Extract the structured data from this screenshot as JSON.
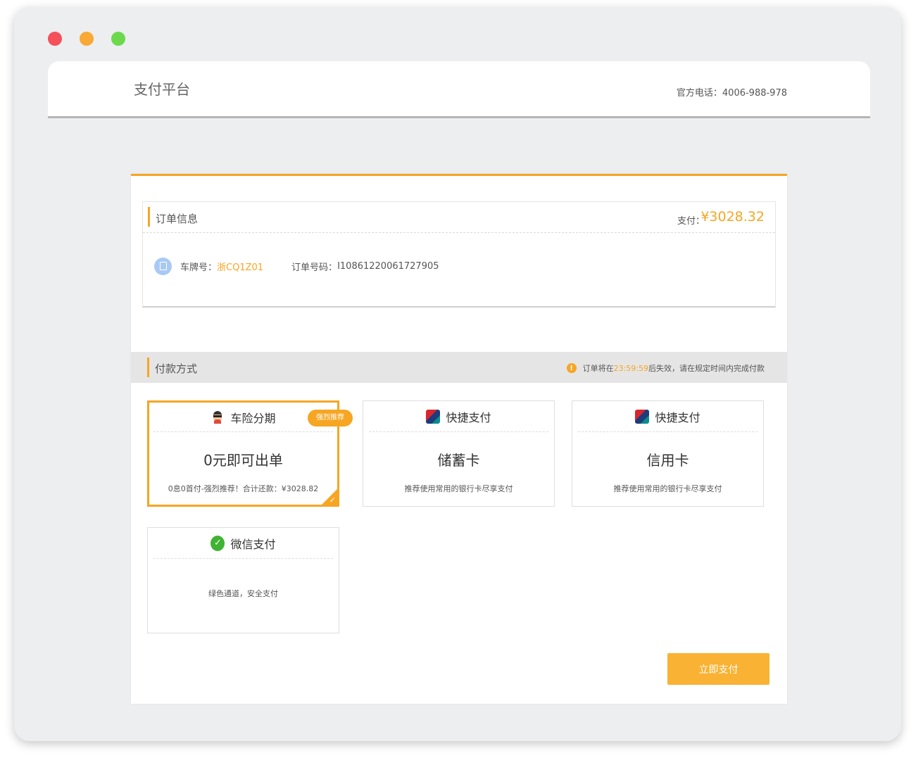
{
  "header": {
    "brand": "支付平台",
    "hotline": "官方电话：4006-988-978"
  },
  "order": {
    "title": "订单信息",
    "pay_label": "支付：",
    "pay_amount": "¥3028.32",
    "plate_label": "车牌号：",
    "plate_value": "浙CQ1Z01",
    "order_no_label": "订单号码：",
    "order_no": "I10861220061727905"
  },
  "payment": {
    "title": "付款方式",
    "warn_prefix": "订单将在",
    "warn_time": "23:59:59",
    "warn_suffix": "后失效，请在规定时间内完成付款",
    "methods": [
      {
        "title": "车险分期",
        "badge": "强烈推荐",
        "big": "0元即可出单",
        "small": "0息0首付-强烈推荐！合计还款：¥3028.82",
        "icon": "mascot-icon"
      },
      {
        "title": "快捷支付",
        "big": "储蓄卡",
        "small": "推荐使用常用的银行卡尽享支付",
        "icon": "unionpay-icon"
      },
      {
        "title": "快捷支付",
        "big": "信用卡",
        "small": "推荐使用常用的银行卡尽享支付",
        "icon": "unionpay-icon"
      },
      {
        "title": "微信支付",
        "small": "绿色通道，安全支付",
        "icon": "wechat-icon"
      }
    ],
    "submit_label": "立即支付"
  },
  "colors": {
    "accent": "#f6a623",
    "button": "#f9b233"
  }
}
